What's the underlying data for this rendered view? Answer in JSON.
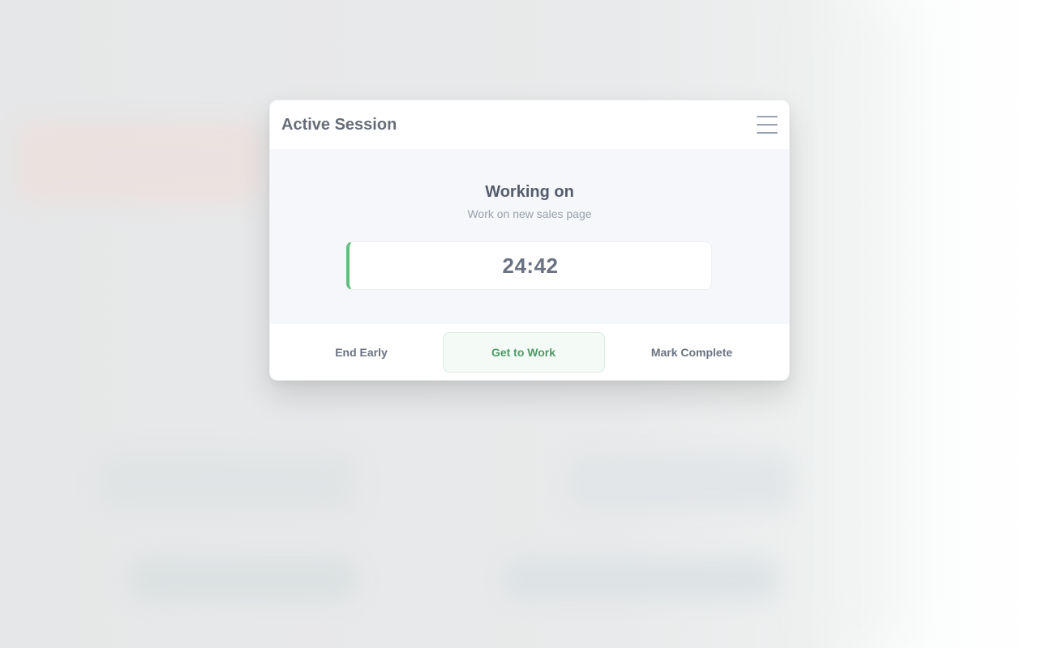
{
  "modal": {
    "title": "Active Session",
    "menu_icon": "hamburger-menu-icon"
  },
  "session": {
    "heading": "Working on",
    "task": "Work on new sales page",
    "timer": "24:42",
    "accent_color": "#5fbf7f"
  },
  "actions": {
    "end_early": "End Early",
    "get_to_work": "Get to Work",
    "mark_complete": "Mark Complete"
  }
}
